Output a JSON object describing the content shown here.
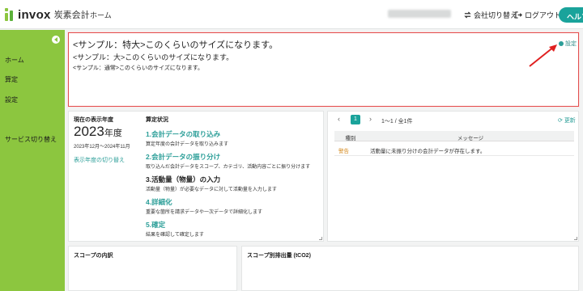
{
  "topbar": {
    "brand": "invox",
    "brand_sub": "炭素会計",
    "nav_home": "ホーム",
    "switch_company": "会社切り替え",
    "logout": "ログアウト",
    "help": "ヘルプ"
  },
  "colors": {
    "accent": "#1aa39b",
    "sidebar": "#8cc63f",
    "highlight_border": "#e24e4e",
    "warning": "#d4881c"
  },
  "sidebar": {
    "items": [
      "ホーム",
      "算定",
      "設定",
      "サービス切り替え"
    ]
  },
  "editor": {
    "line_xl": "<サンプル：特大>このくらいのサイズになります。",
    "line_l": "<サンプル：大>このくらいのサイズになります。",
    "line_n": "<サンプル：通常>このくらいのサイズになります。",
    "settings": "設定"
  },
  "year_panel": {
    "heading": "現在の表示年度",
    "year": "2023",
    "year_suffix": "年度",
    "range": "2023年12月〜2024年11月",
    "switch": "表示年度の切り替え"
  },
  "status_panel": {
    "heading": "算定状況",
    "steps": [
      {
        "title": "1.会計データの取り込み",
        "desc": "算定年度の会計データを取り込みます"
      },
      {
        "title": "2.会計データの振り分け",
        "desc": "取り込んだ会計データをスコープ、カテゴリ、活動内容ごとに振り分けます"
      },
      {
        "title": "3.活動量（物量）の入力",
        "desc": "活動量（物量）が必要なデータに対して活動量を入力します"
      },
      {
        "title": "4.詳細化",
        "desc": "重要な箇所を請求データや一次データで詳細化します"
      },
      {
        "title": "5.確定",
        "desc": "結果を確認して確定します"
      }
    ]
  },
  "messages": {
    "page": "1",
    "page_info": "1〜1 / 全1件",
    "refresh": "更新",
    "col_type": "種別",
    "col_message": "メッセージ",
    "rows": [
      {
        "type": "警告",
        "message": "活動量に未振り分けの会計データが存在します。"
      }
    ]
  },
  "bottom": {
    "scope_title": "スコープの内訳",
    "emission_title": "スコープ別排出量 (tCO2)"
  }
}
